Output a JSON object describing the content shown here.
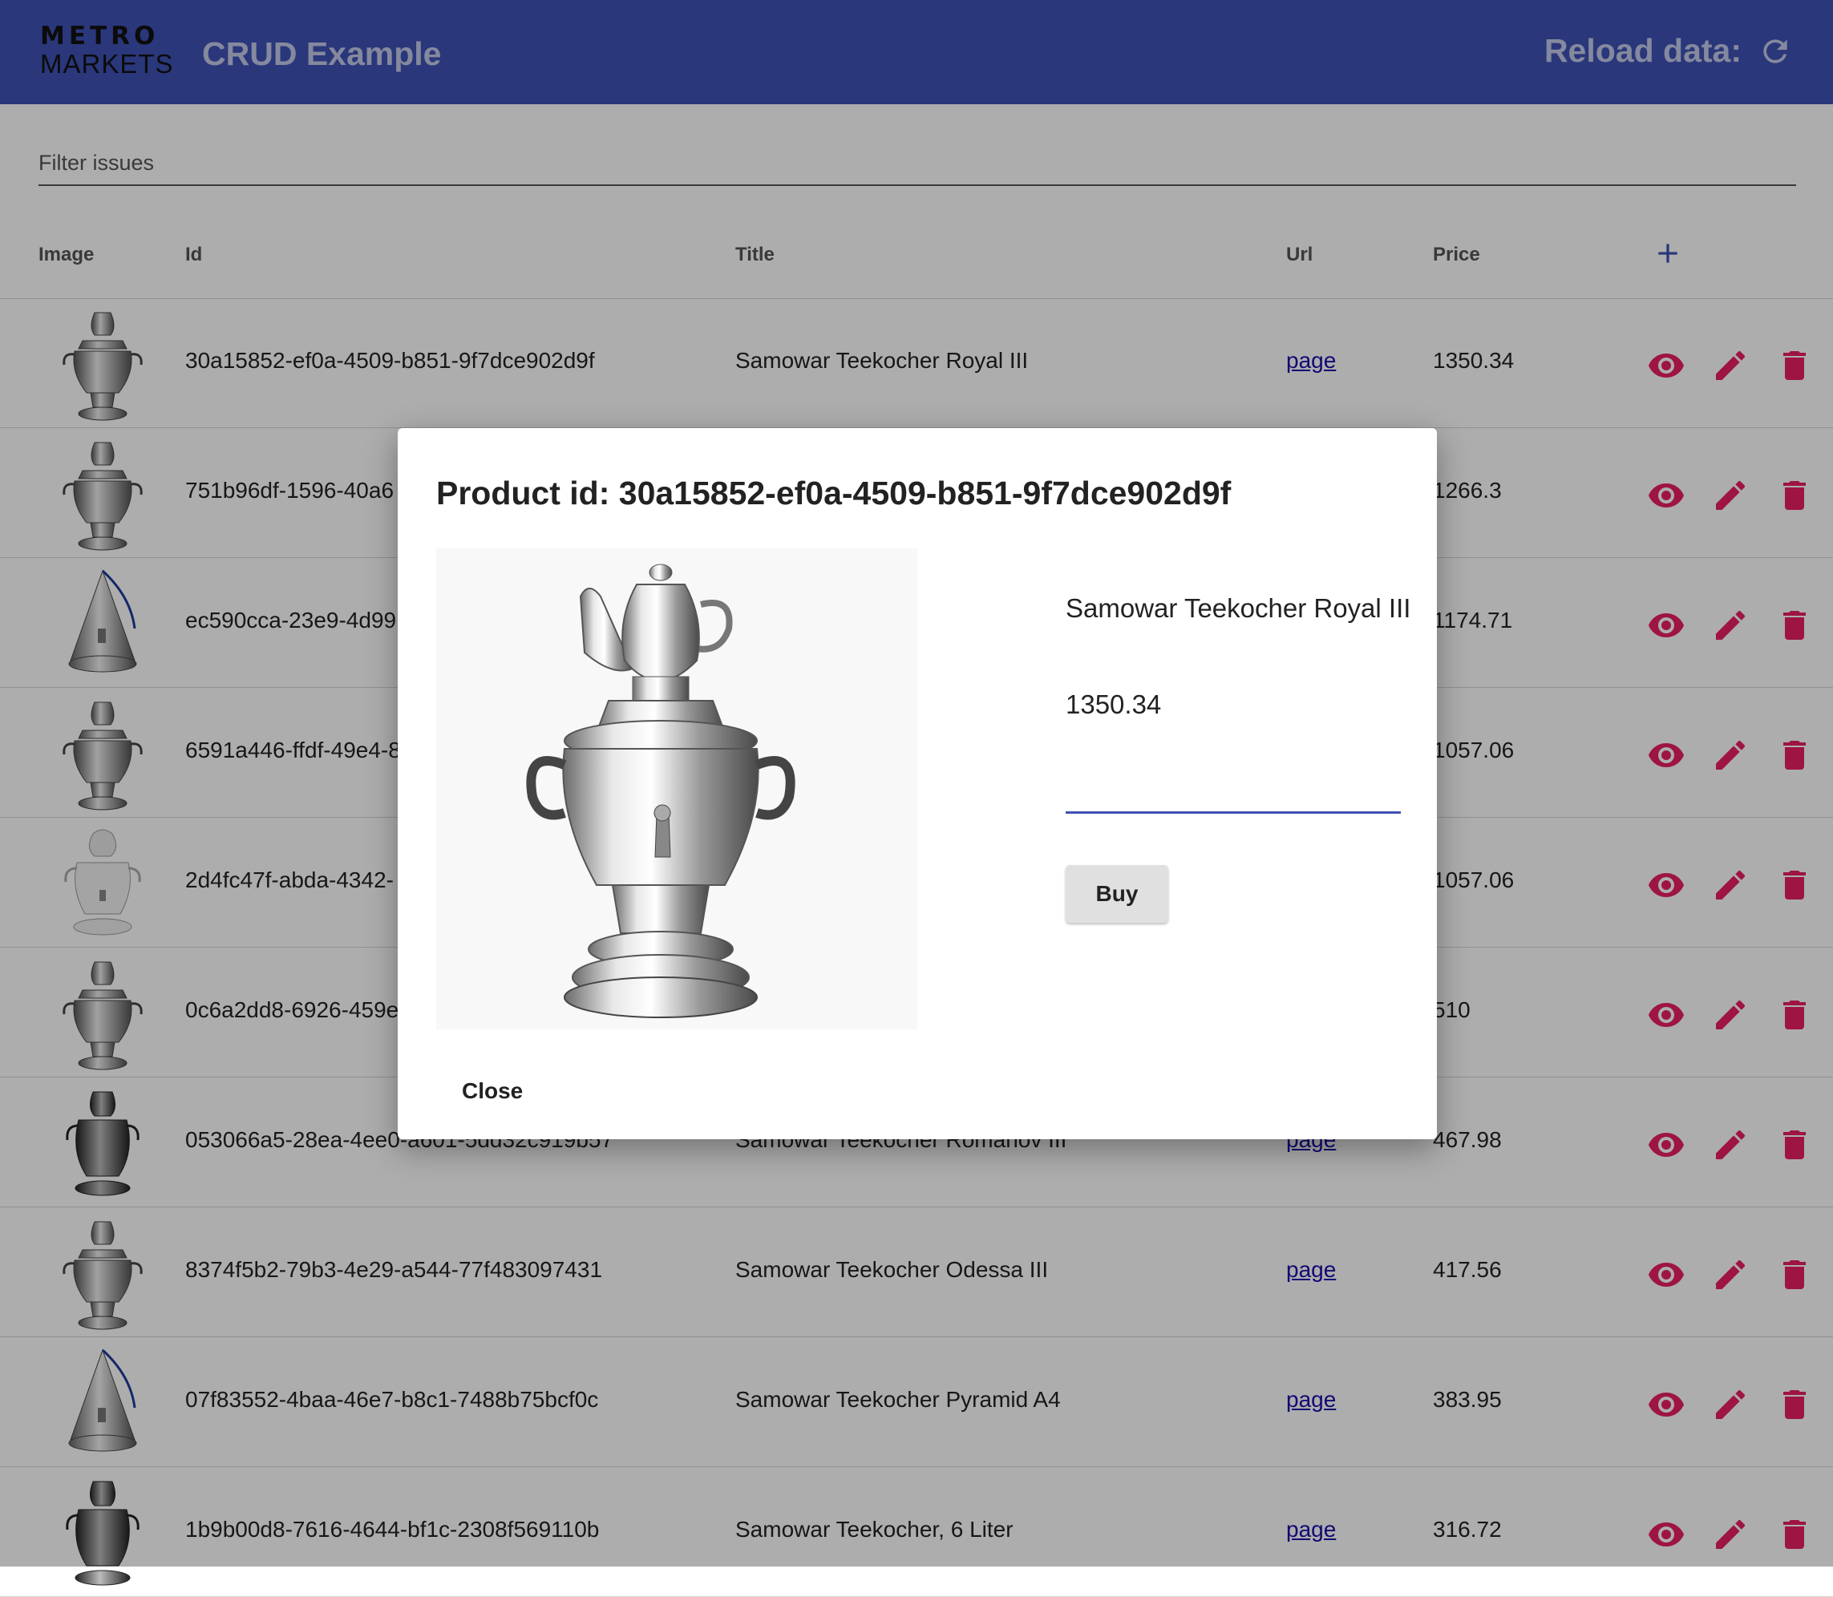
{
  "header": {
    "logo_line1": "METRO",
    "logo_line2": "MARKETS",
    "app_title": "CRUD Example",
    "reload_label": "Reload data:"
  },
  "filter": {
    "placeholder": "Filter issues"
  },
  "table": {
    "columns": {
      "image": "Image",
      "id": "Id",
      "title": "Title",
      "url": "Url",
      "price": "Price"
    },
    "rows": [
      {
        "id": "30a15852-ef0a-4509-b851-9f7dce902d9f",
        "title": "Samowar Teekocher Royal III",
        "url": "page",
        "price": "1350.34",
        "shape": "classic"
      },
      {
        "id": "751b96df-1596-40a6",
        "title": "",
        "url": "",
        "price": "1266.3",
        "shape": "classic"
      },
      {
        "id": "ec590cca-23e9-4d99",
        "title": "",
        "url": "",
        "price": "1174.71",
        "shape": "pyramid"
      },
      {
        "id": "6591a446-ffdf-49e4-8",
        "title": "",
        "url": "",
        "price": "1057.06",
        "shape": "classic"
      },
      {
        "id": "2d4fc47f-abda-4342-",
        "title": "",
        "url": "",
        "price": "1057.06",
        "shape": "white"
      },
      {
        "id": "0c6a2dd8-6926-459e",
        "title": "",
        "url": "",
        "price": "510",
        "shape": "classic"
      },
      {
        "id": "053066a5-28ea-4ee0-a601-5dd32c919b57",
        "title": "Samowar Teekocher Romanov III",
        "url": "page",
        "price": "467.98",
        "shape": "dark"
      },
      {
        "id": "8374f5b2-79b3-4e29-a544-77f483097431",
        "title": "Samowar Teekocher Odessa III",
        "url": "page",
        "price": "417.56",
        "shape": "classic"
      },
      {
        "id": "07f83552-4baa-46e7-b8c1-7488b75bcf0c",
        "title": "Samowar Teekocher Pyramid A4",
        "url": "page",
        "price": "383.95",
        "shape": "pyramid"
      },
      {
        "id": "1b9b00d8-7616-4644-bf1c-2308f569110b",
        "title": "Samowar Teekocher, 6 Liter",
        "url": "page",
        "price": "316.72",
        "shape": "dark"
      }
    ]
  },
  "icons": {
    "refresh": "refresh-icon",
    "add": "plus-icon",
    "view": "eye-icon",
    "edit": "pencil-icon",
    "delete": "trash-icon"
  },
  "colors": {
    "header_bg": "#3f51b5",
    "action_icons": "#e91e63",
    "add_icon": "#3f51b5",
    "link": "#1a0dab"
  },
  "modal": {
    "title": "Product id: 30a15852-ef0a-4509-b851-9f7dce902d9f",
    "product_name": "Samowar Teekocher Royal III",
    "product_price": "1350.34",
    "quantity_value": "",
    "buy_label": "Buy",
    "close_label": "Close"
  }
}
